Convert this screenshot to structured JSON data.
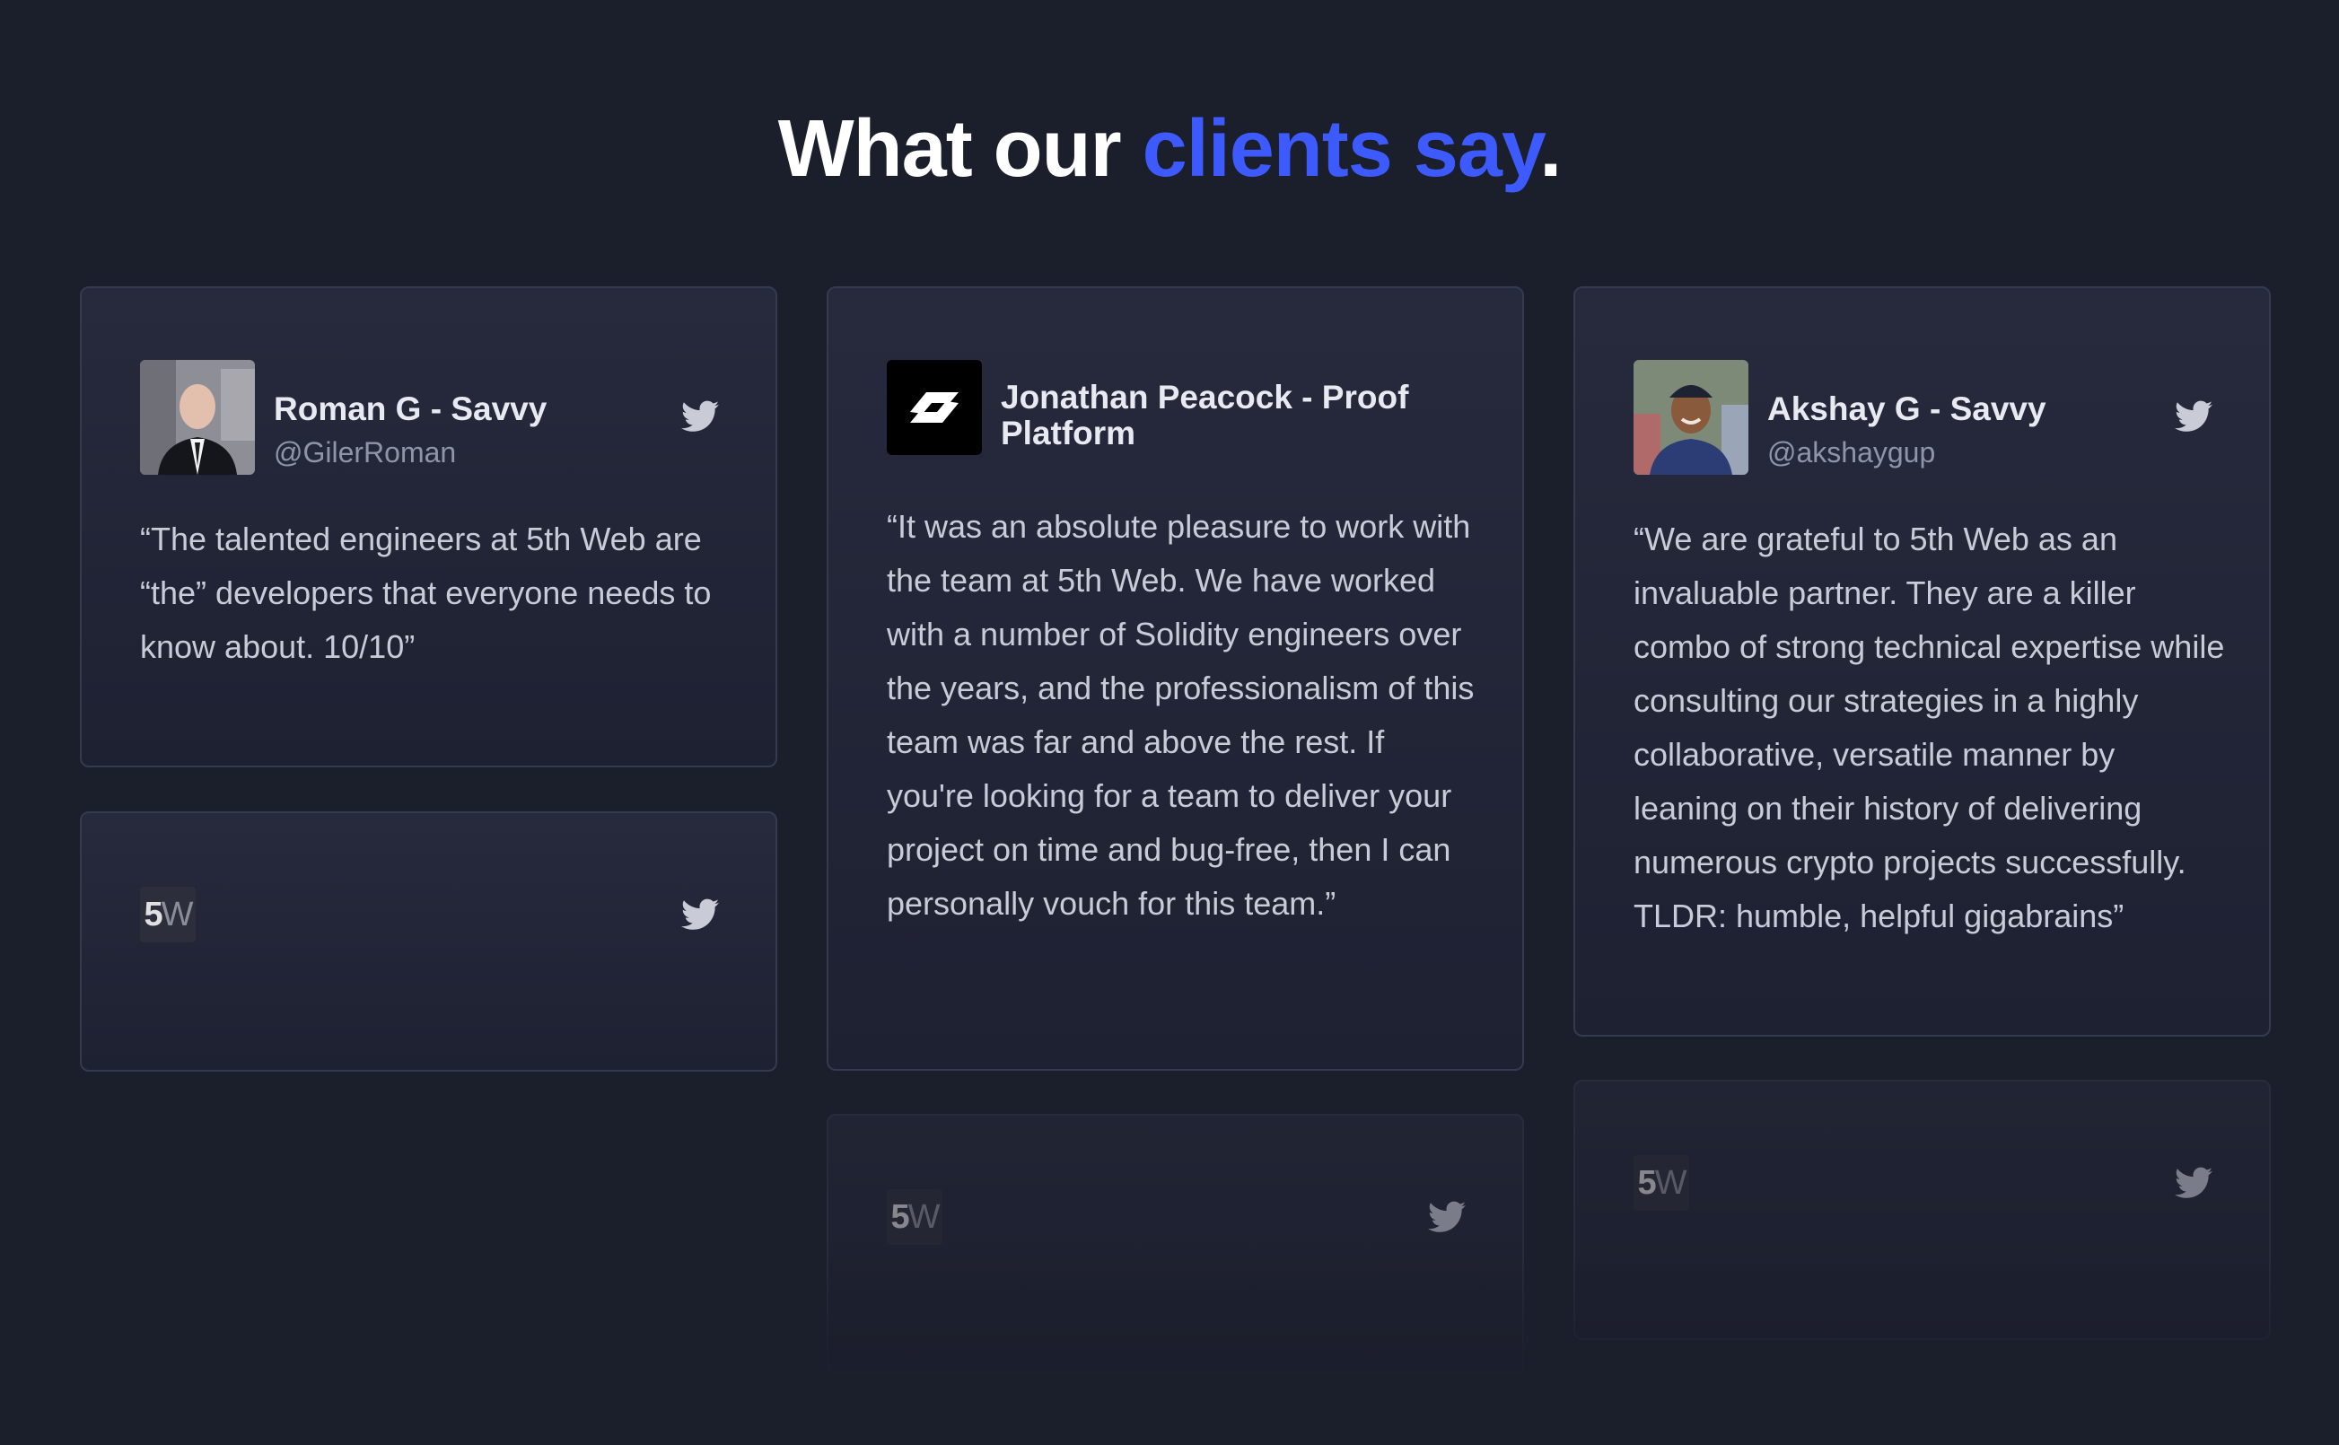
{
  "section": {
    "title_prefix": "What our ",
    "title_accent": "clients say",
    "title_suffix": "."
  },
  "colors": {
    "background": "#1b1e2b",
    "accent": "#3d5afe",
    "card_border": "#343a4f"
  },
  "testimonials": [
    {
      "name": "Roman G - Savvy",
      "handle": "@GilerRoman",
      "avatar_icon": "person-photo",
      "quote": "“The talented engineers at 5th Web are “the” developers that everyone needs to know about. 10/10”"
    },
    {
      "name": "Jonathan Peacock - Proof Platform",
      "handle": "",
      "avatar_icon": "proof-logo",
      "quote": "“It was an absolute pleasure to work with the team at 5th Web. We have worked with a number of Solidity engineers over the years, and the professionalism of this team was far and above the rest. If you're looking for a team to deliver your project on time and bug-free, then I can personally vouch for this team.”"
    },
    {
      "name": "Akshay G - Savvy",
      "handle": "@akshaygup",
      "avatar_icon": "person-photo",
      "quote": "“We are grateful to 5th Web as an invaluable partner. They are a killer combo of strong technical expertise while consulting our strategies in a highly collaborative, versatile manner by leaning on their history of delivering numerous crypto projects successfully. TLDR: humble, helpful gigabrains”"
    }
  ],
  "placeholder_logo": {
    "digit": "5",
    "letter": "W"
  }
}
